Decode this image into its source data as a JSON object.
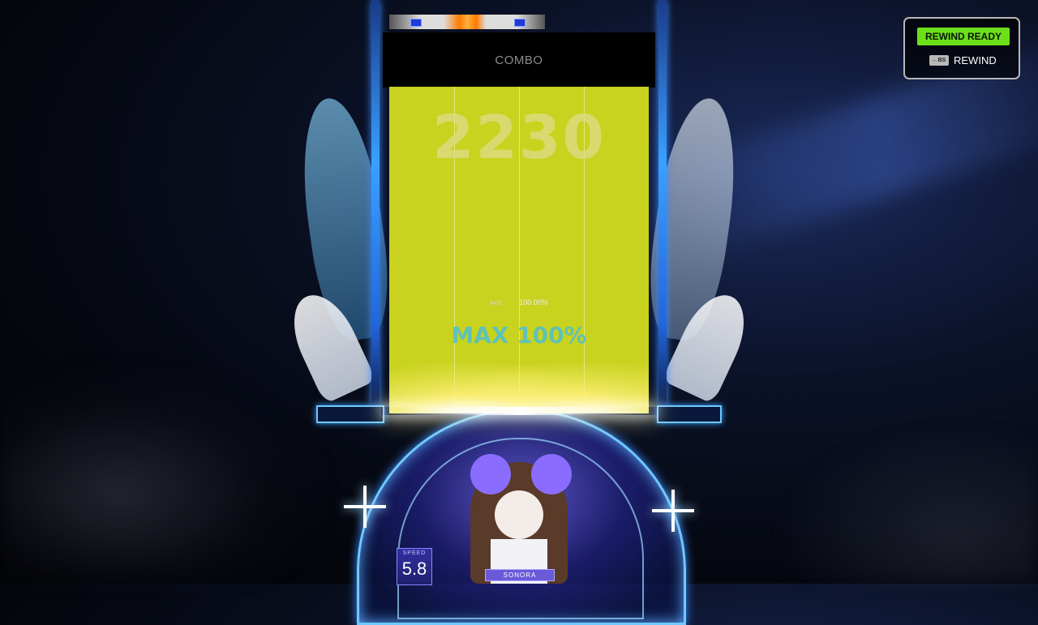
{
  "hud": {
    "combo_label": "COMBO",
    "combo_count": "2230",
    "rate_tag": "RATE",
    "rate_value": "100.00%",
    "max_text": "MAX 100%",
    "speed_label": "SPEED",
    "speed_value": "5.8",
    "character_name": "SONORA"
  },
  "rewind": {
    "ready_label": "REWIND READY",
    "key_label": "←BS",
    "action_label": "REWIND"
  },
  "song_progress": {
    "position": 0.5,
    "marker_positions": [
      0.17,
      0.83
    ]
  },
  "colors": {
    "lane_fill": "#c9d21e",
    "rewind_ready_bg": "#6be01a",
    "frame_accent": "#3aa0ff",
    "progress_highlight": "#ff7a00"
  },
  "icons": [
    "sparkle-icon",
    "backspace-key-icon"
  ]
}
